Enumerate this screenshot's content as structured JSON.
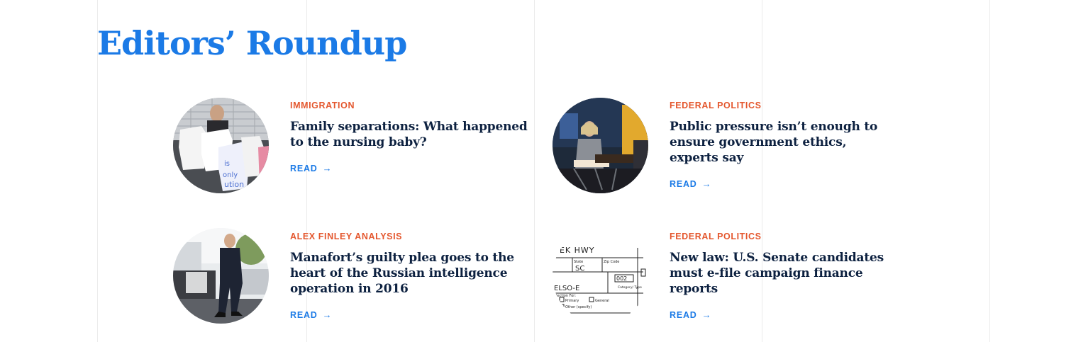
{
  "section": {
    "title": "Editors’ Roundup"
  },
  "articles": [
    {
      "kicker": "IMMIGRATION",
      "headline": "Family separations: What happened to the nursing baby?",
      "read_label": "READ",
      "arrow": "→",
      "thumbnail": "protest-onesies-photo"
    },
    {
      "kicker": "FEDERAL POLITICS",
      "headline": "Public pressure isn’t enough to ensure government ethics, experts say",
      "read_label": "READ",
      "arrow": "→",
      "thumbnail": "panel-discussion-photo"
    },
    {
      "kicker": "ALEX FINLEY ANALYSIS",
      "headline": "Manafort’s guilty plea goes to the heart of the Russian intelligence operation in 2016",
      "read_label": "READ",
      "arrow": "→",
      "thumbnail": "man-walking-photo"
    },
    {
      "kicker": "FEDERAL POLITICS",
      "headline": "New law: U.S. Senate candidates must e-file campaign finance reports",
      "read_label": "READ",
      "arrow": "→",
      "thumbnail": "campaign-form-image",
      "form_text": {
        "hwy": "EEK HWY",
        "state": "SC",
        "state_label": "State",
        "zip_label": "Zip Code",
        "amount": "002",
        "category_label": "Category/ Type",
        "name": "ELSO-E",
        "election_label": "Election For:",
        "primary": "Primary",
        "general": "General",
        "other": "Other (specify)"
      }
    }
  ]
}
